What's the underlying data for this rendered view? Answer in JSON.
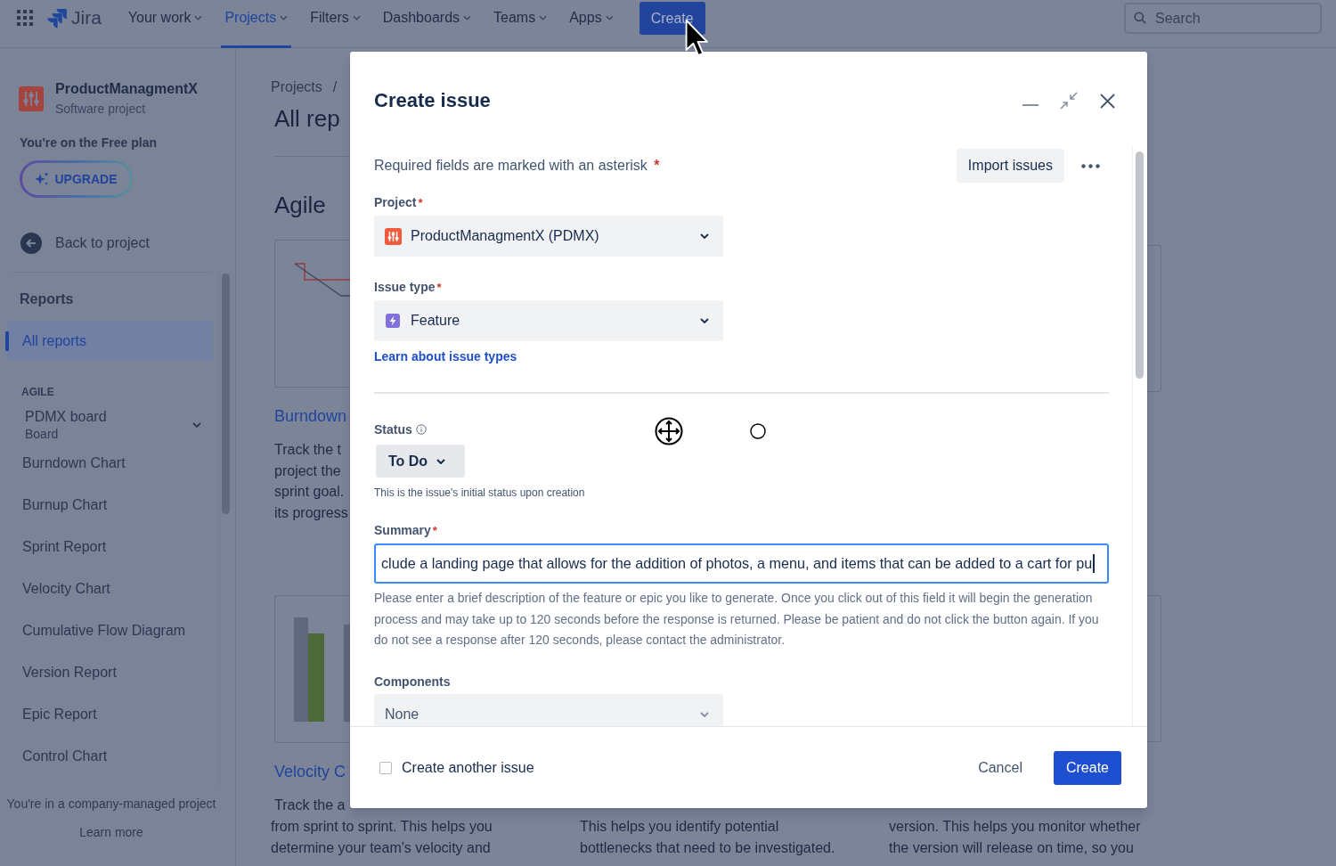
{
  "top_nav": {
    "logo": "Jira",
    "items": [
      {
        "label": "Your work",
        "selected": false
      },
      {
        "label": "Projects",
        "selected": true
      },
      {
        "label": "Filters",
        "selected": false
      },
      {
        "label": "Dashboards",
        "selected": false
      },
      {
        "label": "Teams",
        "selected": false
      },
      {
        "label": "Apps",
        "selected": false
      }
    ],
    "create_button": "Create",
    "search": {
      "placeholder": "Search"
    }
  },
  "sidebar": {
    "project": {
      "name": "ProductManagmentX",
      "type": "Software project"
    },
    "plan_note": "You're on the Free plan",
    "upgrade_button": "UPGRADE",
    "back_link": "Back to project",
    "section_title": "Reports",
    "nav_items": [
      {
        "label": "All reports",
        "selected": true
      }
    ],
    "group_label": "AGILE",
    "board": {
      "name": "PDMX board",
      "subtitle": "Board"
    },
    "reports": [
      {
        "label": "Burndown Chart",
        "selected": false
      },
      {
        "label": "Burnup Chart",
        "selected": false
      },
      {
        "label": "Sprint Report",
        "selected": false
      },
      {
        "label": "Velocity Chart",
        "selected": false
      },
      {
        "label": "Cumulative Flow Diagram",
        "selected": false
      },
      {
        "label": "Version Report",
        "selected": false
      },
      {
        "label": "Epic Report",
        "selected": false
      },
      {
        "label": "Control Chart",
        "selected": false
      }
    ],
    "footer": {
      "note": "You're in a company-managed project",
      "link": "Learn more"
    }
  },
  "page": {
    "breadcrumb": {
      "label": "Projects",
      "separator": "/"
    },
    "title": "All rep",
    "section": "Agile",
    "cards": [
      {
        "kind": "burndown",
        "title": "Burndown",
        "description": [
          "Track the t",
          "project the",
          "sprint goal.",
          "its progress"
        ]
      },
      {
        "kind": "velocity",
        "title": "Velocity C",
        "description": [
          "Track the a"
        ]
      }
    ],
    "lower_descriptions": [
      [
        "from sprint to sprint. This helps you",
        "determine your team's velocity and"
      ],
      [
        "This helps you identify potential",
        "bottlenecks that need to be investigated."
      ],
      [
        "version. This helps you monitor whether",
        "the version will release on time, so you"
      ]
    ]
  },
  "dialog": {
    "title": "Create issue",
    "required_note": "Required fields are marked with an asterisk",
    "required_mark": "*",
    "import_button": "Import issues",
    "fields": [
      {
        "kind": "project",
        "label": "Project",
        "required": true,
        "value": "ProductManagmentX (PDMX)"
      },
      {
        "kind": "issuetype",
        "label": "Issue type",
        "required": true,
        "value": "Feature",
        "link": "Learn about issue types"
      },
      {
        "kind": "status",
        "label": "Status",
        "required": false,
        "value": "To Do",
        "hint": "This is the issue's initial status upon creation"
      },
      {
        "kind": "text",
        "label": "Summary",
        "required": true,
        "focused": true,
        "value": "clude a landing page that allows for the addition of photos, a menu, and items that can be added to a cart for pu",
        "help": "Please enter a brief description of the feature or epic you like to generate. Once you click out of this field it will begin the generation process and may take up to 120 seconds before the response is returned. Please be patient and do not click the button again. If you do not see a response after 120 seconds, please contact the administrator."
      },
      {
        "kind": "select",
        "label": "Components",
        "required": false,
        "value": "None"
      }
    ],
    "footer": {
      "another": {
        "label": "Create another issue",
        "checked": false
      },
      "cancel_button": "Cancel",
      "submit_button": "Create"
    }
  }
}
